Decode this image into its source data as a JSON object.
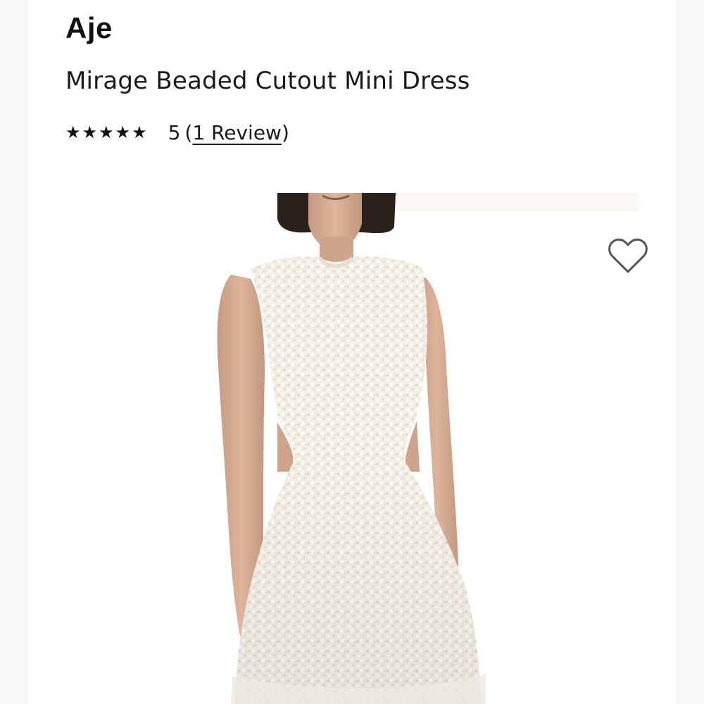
{
  "product": {
    "brand": "Aje",
    "title": "Mirage Beaded Cutout Mini Dress",
    "rating": {
      "stars": "★★★★★",
      "value": "5",
      "review_open": "(",
      "review_link": "1 Review",
      "review_close": ")"
    }
  },
  "icons": {
    "wishlist": "heart-outline-icon",
    "rating": "star-icon"
  },
  "colors": {
    "text": "#111111",
    "dress": "#f4efe8",
    "background": "#ffffff"
  }
}
